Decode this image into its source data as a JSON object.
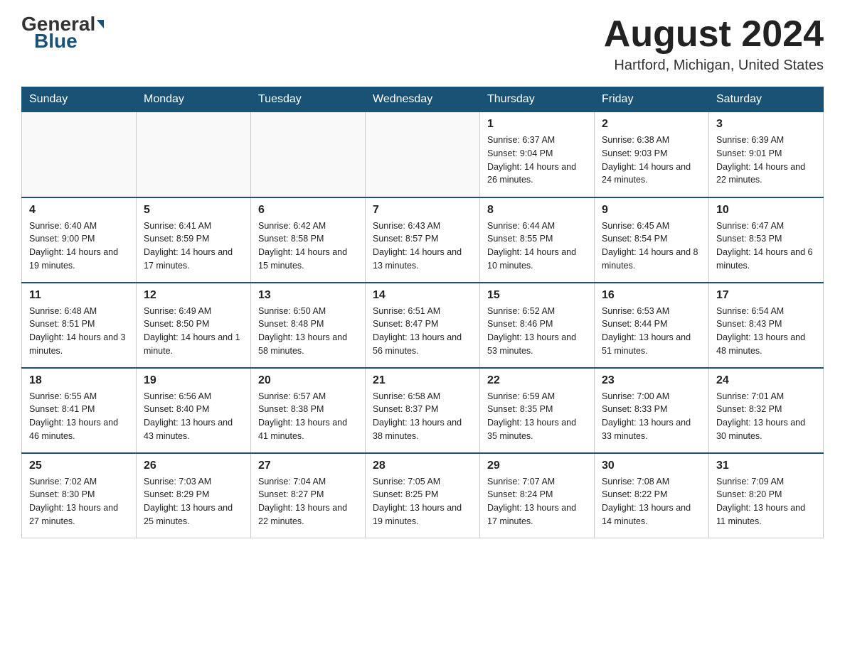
{
  "header": {
    "logo_general": "General",
    "logo_blue": "Blue",
    "month_title": "August 2024",
    "location": "Hartford, Michigan, United States"
  },
  "weekdays": [
    "Sunday",
    "Monday",
    "Tuesday",
    "Wednesday",
    "Thursday",
    "Friday",
    "Saturday"
  ],
  "weeks": [
    [
      {
        "day": "",
        "info": ""
      },
      {
        "day": "",
        "info": ""
      },
      {
        "day": "",
        "info": ""
      },
      {
        "day": "",
        "info": ""
      },
      {
        "day": "1",
        "info": "Sunrise: 6:37 AM\nSunset: 9:04 PM\nDaylight: 14 hours and 26 minutes."
      },
      {
        "day": "2",
        "info": "Sunrise: 6:38 AM\nSunset: 9:03 PM\nDaylight: 14 hours and 24 minutes."
      },
      {
        "day": "3",
        "info": "Sunrise: 6:39 AM\nSunset: 9:01 PM\nDaylight: 14 hours and 22 minutes."
      }
    ],
    [
      {
        "day": "4",
        "info": "Sunrise: 6:40 AM\nSunset: 9:00 PM\nDaylight: 14 hours and 19 minutes."
      },
      {
        "day": "5",
        "info": "Sunrise: 6:41 AM\nSunset: 8:59 PM\nDaylight: 14 hours and 17 minutes."
      },
      {
        "day": "6",
        "info": "Sunrise: 6:42 AM\nSunset: 8:58 PM\nDaylight: 14 hours and 15 minutes."
      },
      {
        "day": "7",
        "info": "Sunrise: 6:43 AM\nSunset: 8:57 PM\nDaylight: 14 hours and 13 minutes."
      },
      {
        "day": "8",
        "info": "Sunrise: 6:44 AM\nSunset: 8:55 PM\nDaylight: 14 hours and 10 minutes."
      },
      {
        "day": "9",
        "info": "Sunrise: 6:45 AM\nSunset: 8:54 PM\nDaylight: 14 hours and 8 minutes."
      },
      {
        "day": "10",
        "info": "Sunrise: 6:47 AM\nSunset: 8:53 PM\nDaylight: 14 hours and 6 minutes."
      }
    ],
    [
      {
        "day": "11",
        "info": "Sunrise: 6:48 AM\nSunset: 8:51 PM\nDaylight: 14 hours and 3 minutes."
      },
      {
        "day": "12",
        "info": "Sunrise: 6:49 AM\nSunset: 8:50 PM\nDaylight: 14 hours and 1 minute."
      },
      {
        "day": "13",
        "info": "Sunrise: 6:50 AM\nSunset: 8:48 PM\nDaylight: 13 hours and 58 minutes."
      },
      {
        "day": "14",
        "info": "Sunrise: 6:51 AM\nSunset: 8:47 PM\nDaylight: 13 hours and 56 minutes."
      },
      {
        "day": "15",
        "info": "Sunrise: 6:52 AM\nSunset: 8:46 PM\nDaylight: 13 hours and 53 minutes."
      },
      {
        "day": "16",
        "info": "Sunrise: 6:53 AM\nSunset: 8:44 PM\nDaylight: 13 hours and 51 minutes."
      },
      {
        "day": "17",
        "info": "Sunrise: 6:54 AM\nSunset: 8:43 PM\nDaylight: 13 hours and 48 minutes."
      }
    ],
    [
      {
        "day": "18",
        "info": "Sunrise: 6:55 AM\nSunset: 8:41 PM\nDaylight: 13 hours and 46 minutes."
      },
      {
        "day": "19",
        "info": "Sunrise: 6:56 AM\nSunset: 8:40 PM\nDaylight: 13 hours and 43 minutes."
      },
      {
        "day": "20",
        "info": "Sunrise: 6:57 AM\nSunset: 8:38 PM\nDaylight: 13 hours and 41 minutes."
      },
      {
        "day": "21",
        "info": "Sunrise: 6:58 AM\nSunset: 8:37 PM\nDaylight: 13 hours and 38 minutes."
      },
      {
        "day": "22",
        "info": "Sunrise: 6:59 AM\nSunset: 8:35 PM\nDaylight: 13 hours and 35 minutes."
      },
      {
        "day": "23",
        "info": "Sunrise: 7:00 AM\nSunset: 8:33 PM\nDaylight: 13 hours and 33 minutes."
      },
      {
        "day": "24",
        "info": "Sunrise: 7:01 AM\nSunset: 8:32 PM\nDaylight: 13 hours and 30 minutes."
      }
    ],
    [
      {
        "day": "25",
        "info": "Sunrise: 7:02 AM\nSunset: 8:30 PM\nDaylight: 13 hours and 27 minutes."
      },
      {
        "day": "26",
        "info": "Sunrise: 7:03 AM\nSunset: 8:29 PM\nDaylight: 13 hours and 25 minutes."
      },
      {
        "day": "27",
        "info": "Sunrise: 7:04 AM\nSunset: 8:27 PM\nDaylight: 13 hours and 22 minutes."
      },
      {
        "day": "28",
        "info": "Sunrise: 7:05 AM\nSunset: 8:25 PM\nDaylight: 13 hours and 19 minutes."
      },
      {
        "day": "29",
        "info": "Sunrise: 7:07 AM\nSunset: 8:24 PM\nDaylight: 13 hours and 17 minutes."
      },
      {
        "day": "30",
        "info": "Sunrise: 7:08 AM\nSunset: 8:22 PM\nDaylight: 13 hours and 14 minutes."
      },
      {
        "day": "31",
        "info": "Sunrise: 7:09 AM\nSunset: 8:20 PM\nDaylight: 13 hours and 11 minutes."
      }
    ]
  ]
}
